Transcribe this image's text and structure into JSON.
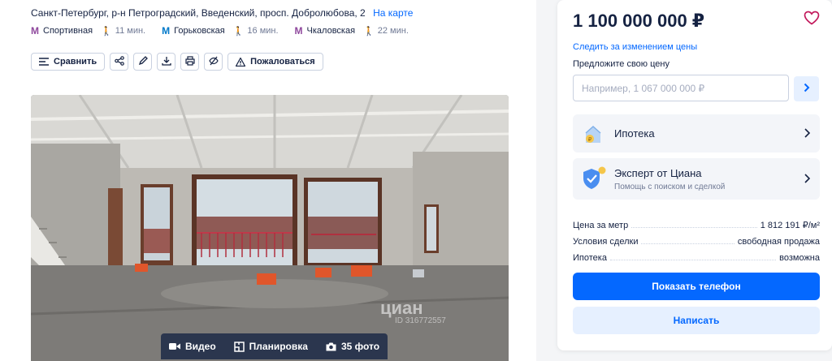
{
  "address": {
    "text": "Санкт-Петербург, р-н Петроградский, Введенский, просп. Добролюбова, 2",
    "map_link": "На карте"
  },
  "metro": [
    {
      "name": "Спортивная",
      "time": "11 мин.",
      "color": "#8e479c"
    },
    {
      "name": "Горьковская",
      "time": "16 мин.",
      "color": "#0078c9"
    },
    {
      "name": "Чкаловская",
      "time": "22 мин.",
      "color": "#8e479c"
    }
  ],
  "toolbar": {
    "compare_label": "Сравнить",
    "report_label": "Пожаловаться",
    "icons": [
      "compare-icon",
      "share-icon",
      "edit-icon",
      "download-icon",
      "print-icon",
      "hide-icon",
      "warning-icon"
    ]
  },
  "gallery": {
    "watermark": "циан",
    "watermark_id": "ID 316772557",
    "video_label": "Видео",
    "plan_label": "Планировка",
    "photos_label": "35 фото"
  },
  "card": {
    "price": "1 100 000 000 ₽",
    "track_price": "Следить за изменением цены",
    "offer_label": "Предложите свою цену",
    "offer_placeholder": "Например, 1 067 000 000 ₽",
    "mortgage_title": "Ипотека",
    "expert_title": "Эксперт от Циана",
    "expert_subtitle": "Помощь с поиском и сделкой",
    "params": [
      {
        "key": "Цена за метр",
        "value": "1 812 191 ₽/м²"
      },
      {
        "key": "Условия сделки",
        "value": "свободная продажа"
      },
      {
        "key": "Ипотека",
        "value": "возможна"
      }
    ],
    "phone_button": "Показать телефон",
    "write_button": "Написать"
  },
  "colors": {
    "accent": "#0468ff",
    "accent_light": "#e6f0ff",
    "text": "#152242",
    "muted": "#707a95",
    "favorite": "#c2185b"
  }
}
